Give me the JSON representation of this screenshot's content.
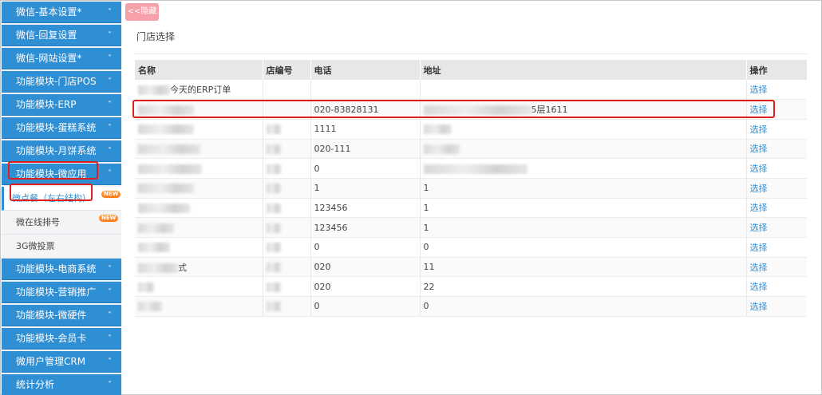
{
  "sidebar": {
    "menus_top": [
      {
        "label": "微信-基本设置*"
      },
      {
        "label": "微信-回复设置"
      },
      {
        "label": "微信-网站设置*"
      },
      {
        "label": "功能模块-门店POS"
      },
      {
        "label": "功能模块-ERP"
      },
      {
        "label": "功能模块-蛋糕系统"
      },
      {
        "label": "功能模块-月饼系统"
      }
    ],
    "open_menu": {
      "label": "功能模块-微应用"
    },
    "sub_items": [
      {
        "label": "微点餐（左右结构）",
        "badge": "NEW"
      },
      {
        "label": "微在线排号",
        "badge": "NEW"
      },
      {
        "label": "3G微投票",
        "badge": ""
      }
    ],
    "menus_bottom": [
      {
        "label": "功能模块-电商系统"
      },
      {
        "label": "功能模块-营销推广"
      },
      {
        "label": "功能模块-微硬件"
      },
      {
        "label": "功能模块-会员卡"
      },
      {
        "label": "微用户管理CRM"
      },
      {
        "label": "统计分析"
      }
    ],
    "chevron_down": "˅",
    "chevron_up": "˄"
  },
  "toggle": {
    "label": "<<隐藏"
  },
  "page": {
    "title": "门店选择"
  },
  "table": {
    "headers": {
      "name": "名称",
      "code": "店编号",
      "phone": "电话",
      "address": "地址",
      "op": "操作"
    },
    "rows": [
      {
        "name": "今天的ERP订单",
        "code": "",
        "phone": "",
        "address": "",
        "op": "选择"
      },
      {
        "name": "",
        "code": "",
        "phone": "020-83828131",
        "address": "5层1611",
        "op": "选择"
      },
      {
        "name": "",
        "code": "",
        "phone": "1111",
        "address": "",
        "op": "选择"
      },
      {
        "name": "",
        "code": "",
        "phone": "020-111",
        "address": "",
        "op": "选择"
      },
      {
        "name": "",
        "code": "",
        "phone": "0",
        "address": "",
        "op": "选择"
      },
      {
        "name": "",
        "code": "",
        "phone": "1",
        "address": "1",
        "op": "选择"
      },
      {
        "name": "",
        "code": "",
        "phone": "123456",
        "address": "1",
        "op": "选择"
      },
      {
        "name": "",
        "code": "",
        "phone": "123456",
        "address": "1",
        "op": "选择"
      },
      {
        "name": "",
        "code": "",
        "phone": "0",
        "address": "0",
        "op": "选择"
      },
      {
        "name": "式",
        "code": "",
        "phone": "020",
        "address": "11",
        "op": "选择"
      },
      {
        "name": "",
        "code": "",
        "phone": "020",
        "address": "22",
        "op": "选择"
      },
      {
        "name": "",
        "code": "",
        "phone": "0",
        "address": "0",
        "op": "选择"
      }
    ]
  },
  "colors": {
    "menu_bg": "#2f8fd5",
    "highlight": "#e01e1e",
    "link": "#2f8fd5",
    "toggle_bg": "#f6a1a9"
  }
}
